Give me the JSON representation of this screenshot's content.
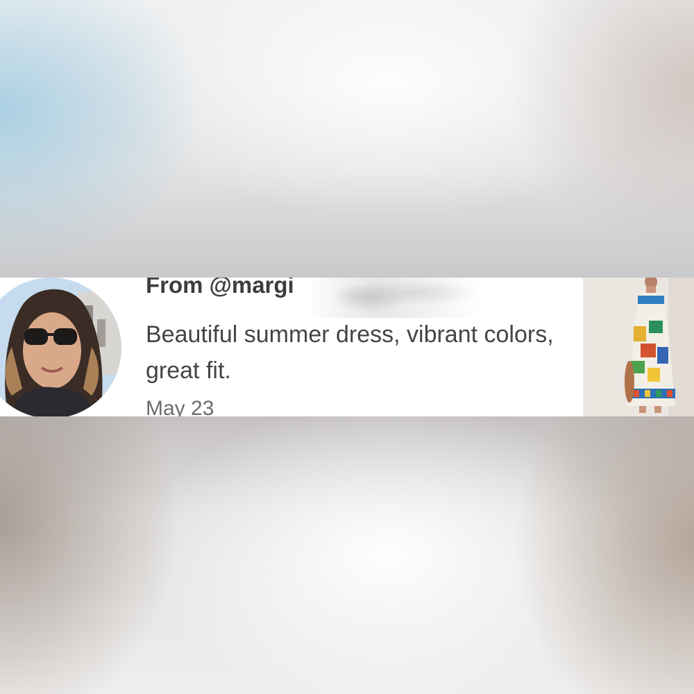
{
  "review": {
    "from_label": "From @margi",
    "text": "Beautiful summer dress, vibrant colors, great fit.",
    "date": "May 23"
  },
  "icons": {
    "avatar": "reviewer-avatar-photo",
    "product": "product-thumbnail-dress"
  },
  "colors": {
    "text_primary": "#3d3d3d",
    "text_body": "#444444",
    "text_muted": "#6b6b6b",
    "card_background": "#ffffff"
  }
}
